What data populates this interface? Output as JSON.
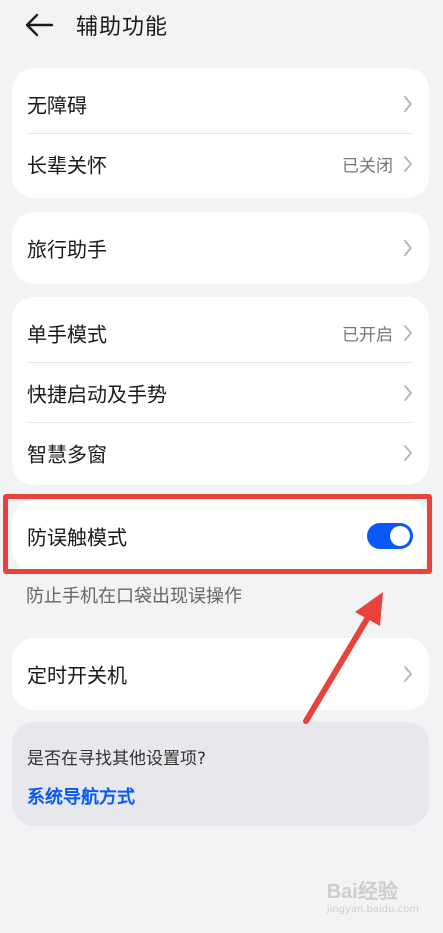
{
  "header": {
    "title": "辅助功能",
    "back_icon": "arrow-left-icon"
  },
  "groups": [
    {
      "items": [
        {
          "label": "无障碍",
          "value": ""
        },
        {
          "label": "长辈关怀",
          "value": "已关闭"
        }
      ]
    },
    {
      "items": [
        {
          "label": "旅行助手",
          "value": ""
        }
      ]
    },
    {
      "items": [
        {
          "label": "单手模式",
          "value": "已开启"
        },
        {
          "label": "快捷启动及手势",
          "value": ""
        },
        {
          "label": "智慧多窗",
          "value": ""
        }
      ]
    }
  ],
  "mistouch": {
    "label": "防误触模式",
    "toggle_on": true,
    "hint": "防止手机在口袋出现误操作",
    "highlight_color": "#e8423a"
  },
  "timer": {
    "label": "定时开关机"
  },
  "search": {
    "question": "是否在寻找其他设置项?",
    "link": "系统导航方式"
  },
  "watermark": {
    "logo": "Bai经验",
    "sub": "jingyan.baidu.com"
  },
  "colors": {
    "accent": "#0a59f7",
    "annotation": "#e8423a",
    "background": "#f1f3f5"
  }
}
